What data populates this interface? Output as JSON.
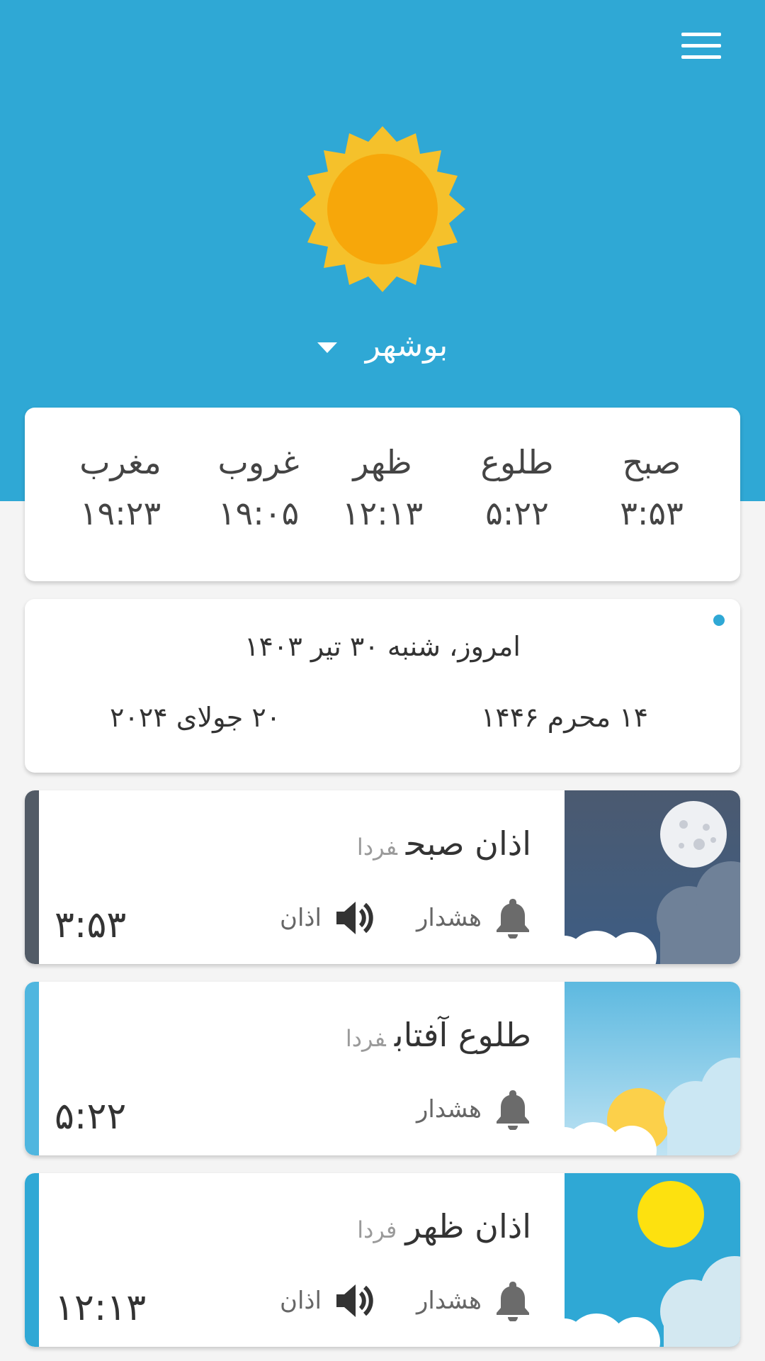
{
  "city": "بوشهر",
  "prayer_times": [
    {
      "name": "صبح",
      "time": "۳:۵۳"
    },
    {
      "name": "طلوع",
      "time": "۵:۲۲"
    },
    {
      "name": "ظهر",
      "time": "۱۲:۱۳"
    },
    {
      "name": "غروب",
      "time": "۱۹:۰۵"
    },
    {
      "name": "مغرب",
      "time": "۱۹:۲۳"
    }
  ],
  "date": {
    "today": "امروز، شنبه ۳۰ تیر ۱۴۰۳",
    "hijri": "۱۴ محرم ۱۴۴۶",
    "gregorian": "۲۰ جولای ۲۰۲۴"
  },
  "alarms": [
    {
      "title": "اذان صبح",
      "tomorrow": "فردا",
      "time": "۳:۵۳",
      "alert_label": "هشدار",
      "azan_label": "اذان",
      "stripe_color": "#525b66"
    },
    {
      "title": "طلوع آفتاب",
      "tomorrow": "فردا",
      "time": "۵:۲۲",
      "alert_label": "هشدار",
      "stripe_color": "#4fb6df"
    },
    {
      "title": "اذان ظهر",
      "tomorrow": "فردا",
      "time": "۱۲:۱۳",
      "alert_label": "هشدار",
      "azan_label": "اذان",
      "stripe_color": "#2fa8d5"
    }
  ],
  "colors": {
    "header": "#2fa8d5",
    "sun_outer": "#f5c12b",
    "sun_inner": "#f7a70a"
  }
}
